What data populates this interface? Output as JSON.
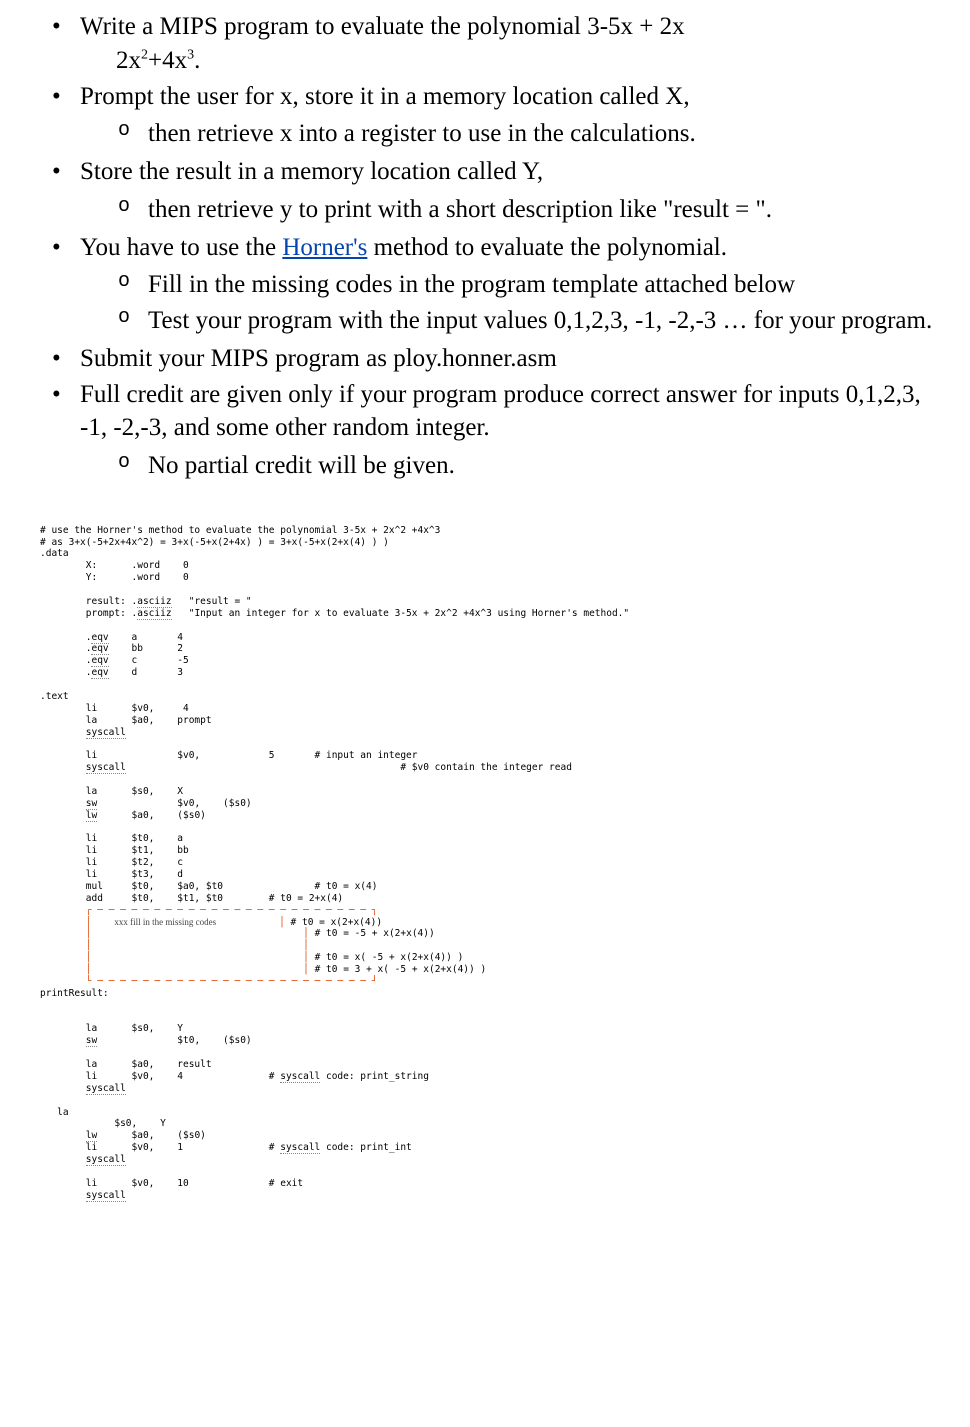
{
  "bullets": {
    "b1_part1": "Write a MIPS program to evaluate the polynomial 3-5x + 2x",
    "b1_sup1": "2",
    "b1_mid": "+4x",
    "b1_sup2": "3",
    "b1_end": ".",
    "b2": "Prompt the user for x, store it in a memory location called X,",
    "b2_sub1": " then retrieve x into a register to use in the calculations.",
    "b3": "Store the result in a memory location called Y,",
    "b3_sub1": " then retrieve y to print with a short description like \"result = \".",
    "b4_part1": "You have to use the ",
    "b4_link": "Horner's",
    "b4_part2": " method to evaluate the polynomial.",
    "b4_sub1": " Fill in the missing codes in the program template attached below",
    "b4_sub2": " Test your program with the input values 0,1,2,3, -1, -2,-3 … for your program.",
    "b5": "Submit your MIPS program as ploy.honner.asm",
    "b6": "Full credit are given only if your program produce correct answer for inputs 0,1,2,3, -1, -2,-3,  and some other random integer.",
    "b6_sub1": " No partial credit will be given."
  },
  "code": {
    "l1": "# use the Horner's method to evaluate the polynomial 3-5x + 2x^2 +4x^3",
    "l2": "# as 3+x(-5+2x+4x^2) = 3+x(-5+x(2+4x) ) = 3+x(-5+x(2+x(4) ) )",
    "l3": ".data",
    "l4": "        X:      .word    0",
    "l5": "        Y:      .word    0",
    "l6a": "        result: .",
    "l6dir": "asciiz",
    "l6b": "   \"result = \"",
    "l7a": "        prompt: .",
    "l7dir": "asciiz",
    "l7b": "   \"Input an integer for x to evaluate 3-5x + 2x^2 +4x^3 using Horner's method.\"",
    "l8a": "        .",
    "l8dir": "eqv",
    "l8b": "    a       4",
    "l9b": "    bb      2",
    "l10b": "    c       -5",
    "l11b": "    d       3",
    "l12": ".text",
    "l13a": "        li      $v0,     4",
    "l14a": "        la      $a0,    prompt",
    "l15a": "        ",
    "sys": "syscall",
    "l16a": "        li              $v0,            5       # input an integer",
    "l16c": "                                                # $v0 contain the integer read",
    "l18": "        la      $s0,    X",
    "l19a": "        ",
    "sw": "sw",
    "l19b": "              $v0,    ($s0)",
    "l20a": "        ",
    "lw": "lw",
    "l20b": "      $a0,    ($s0)",
    "l21": "        li      $t0,    a",
    "l22": "        li      $t1,    bb",
    "l23": "        li      $t2,    c",
    "l24": "        li      $t3,    d",
    "l25": "        mul     $t0,    $a0, $t0                # t0 = x(4)",
    "l26": "        add     $t0,    $t1, $t0        # t0 = 2+x(4)",
    "dash_top": "        ┌ ─ ─ ─ ─ ─ ─ ─ ─ ─ ─ ─ ─ ─ ─ ─ ─ ─ ─ ─ ─ ─ ─ ─ ─ ┐",
    "fill_label": "xxx fill in the missing codes",
    "c27": "# t0 = x(2+x(4))",
    "c28": "# t0 = -5 + x(2+x(4))",
    "c29": "# t0 = x( -5 + x(2+x(4)) )",
    "c30": "# t0 = 3 + x( -5 + x(2+x(4)) )",
    "dash_bot": "        └ ─ ─ ─ ─ ─ ─ ─ ─ ─ ─ ─ ─ ─ ─ ─ ─ ─ ─ ─ ─ ─ ─ ─ ─ ┘",
    "l31": "printResult:",
    "l32": "        la      $s0,    Y",
    "l33a": "        ",
    "l33b": "              $t0,    ($s0)",
    "l34": "        la      $a0,    result",
    "l35": "        li      $v0,    4               # ",
    "l35cmt": " code: print_string",
    "l36": "   la",
    "l37": "             $s0,    Y",
    "l38b": "      $a0,    ($s0)",
    "l39": "        li      $v0,    1               # ",
    "l39cmt": " code: print_int",
    "l40": "        li      $v0,    10              # exit"
  }
}
